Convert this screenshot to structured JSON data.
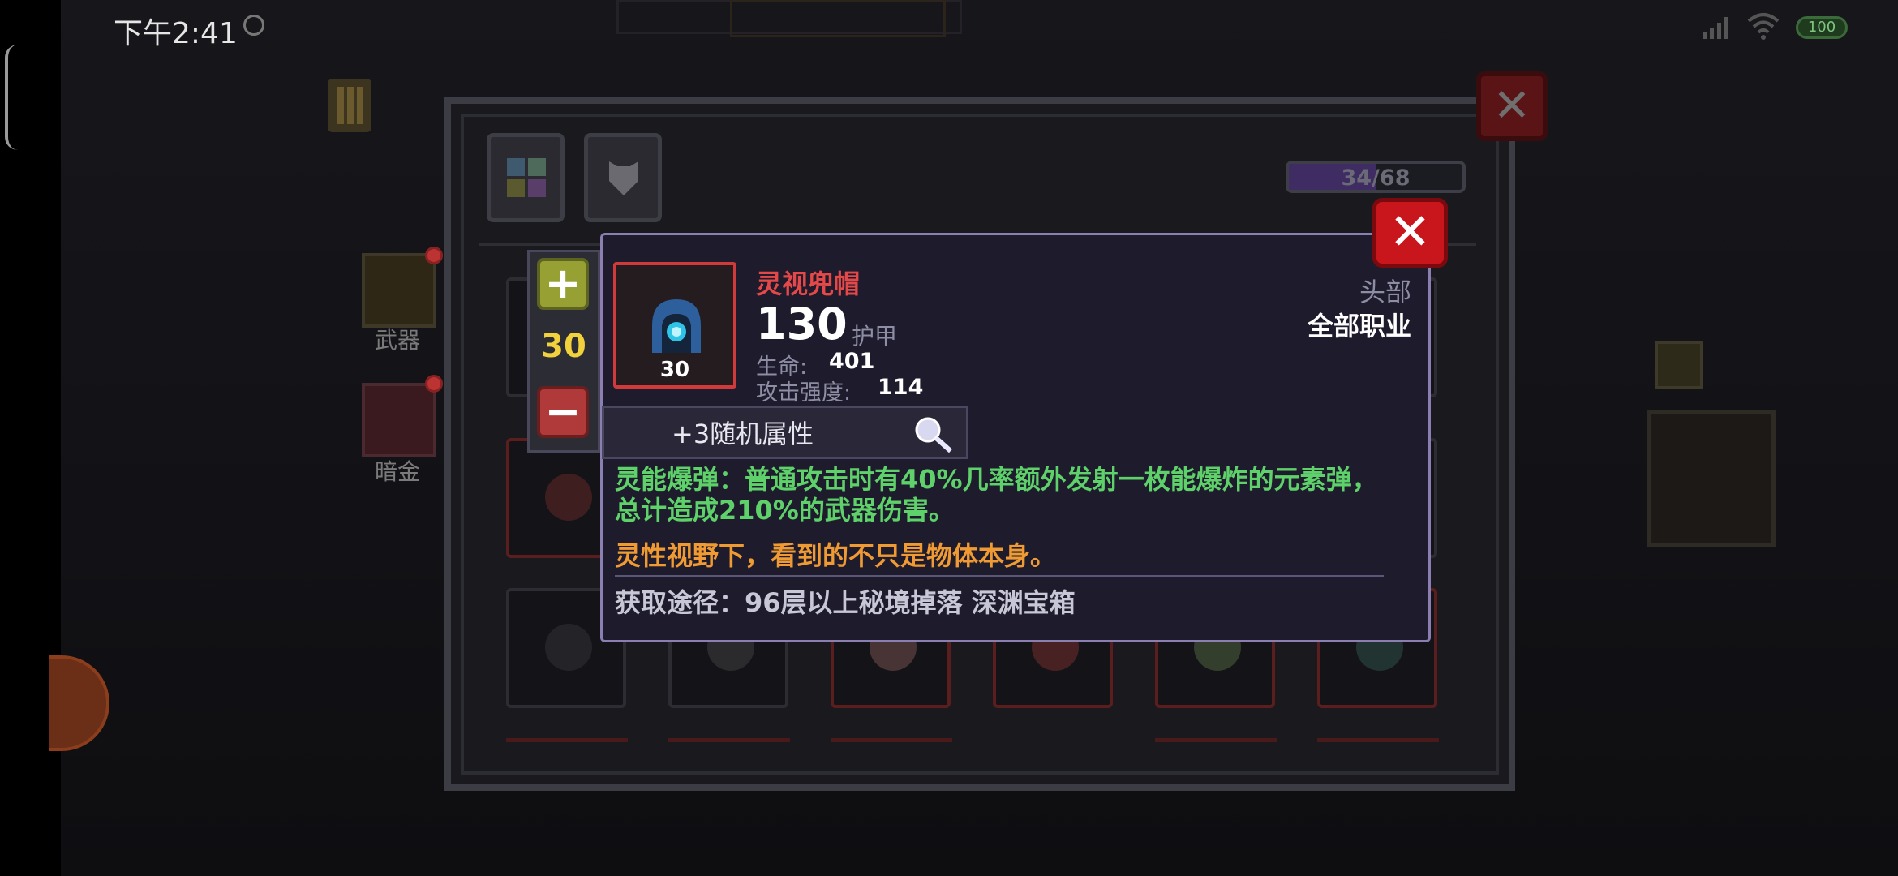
{
  "status_bar": {
    "time": "下午2:41",
    "battery": "100",
    "icons": [
      "alarm-icon",
      "signal-icon",
      "wifi-icon",
      "battery-icon"
    ]
  },
  "side_menu": {
    "weapon_label": "武器",
    "dark_gold_label": "暗金"
  },
  "inventory": {
    "progress_text": "34/68",
    "progress_fraction": 0.5
  },
  "level_control": {
    "value": "30"
  },
  "item": {
    "name": "灵视兜帽",
    "level": "30",
    "armor_value": "130",
    "armor_label": "护甲",
    "stats": [
      {
        "label": "生命:",
        "value": "401"
      },
      {
        "label": "攻击强度:",
        "value": "114"
      }
    ],
    "slot": "头部",
    "class": "全部职业",
    "random_attr": "+3随机属性",
    "effect": "灵能爆弹：普通攻击时有40%几率额外发射一枚能爆炸的元素弹，总计造成210%的武器伤害。",
    "flavor": "灵性视野下，看到的不只是物体本身。",
    "source": "获取途径：96层以上秘境掉落 深渊宝箱"
  },
  "colors": {
    "item_name": "#e44848",
    "effect_text": "#5fd16a",
    "flavor_text": "#f09a34",
    "level_value": "#f2d23c",
    "close_button": "#c9161c"
  }
}
